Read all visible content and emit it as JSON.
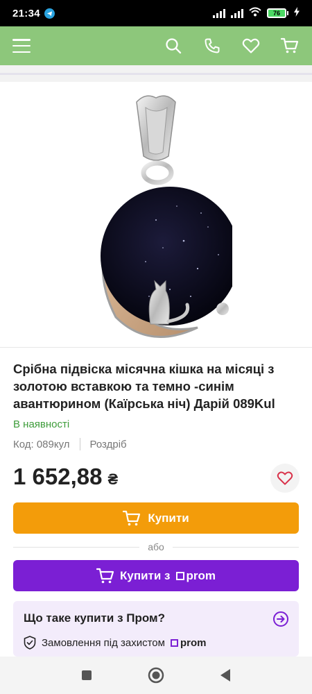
{
  "status_bar": {
    "time": "21:34",
    "battery_level": "76"
  },
  "header": {
    "icons": [
      "menu-icon",
      "search-icon",
      "phone-icon",
      "heart-icon",
      "cart-icon"
    ]
  },
  "product": {
    "title": "Срібна підвіска місячна кішка на місяці з золотою вставкою та темно -синім авантюрином (Каїрська ніч) Дарій 089Kul",
    "availability": "В наявності",
    "code": "Код: 089кул",
    "sale_type": "Роздріб",
    "price": "1 652,88",
    "currency": "₴"
  },
  "actions": {
    "buy_label": "Купити",
    "or_label": "або",
    "buy_prom_label": "Купити з",
    "prom_brand": "prom"
  },
  "info_card": {
    "question": "Що таке купити з Пром?",
    "protection": "Замовлення під захистом",
    "prom_brand": "prom"
  },
  "colors": {
    "header_bg": "#8dc77b",
    "buy_button": "#f39c0a",
    "prom_button": "#7b1fd4",
    "availability": "#3d9c3a",
    "info_card_bg": "#f3ecfb"
  }
}
